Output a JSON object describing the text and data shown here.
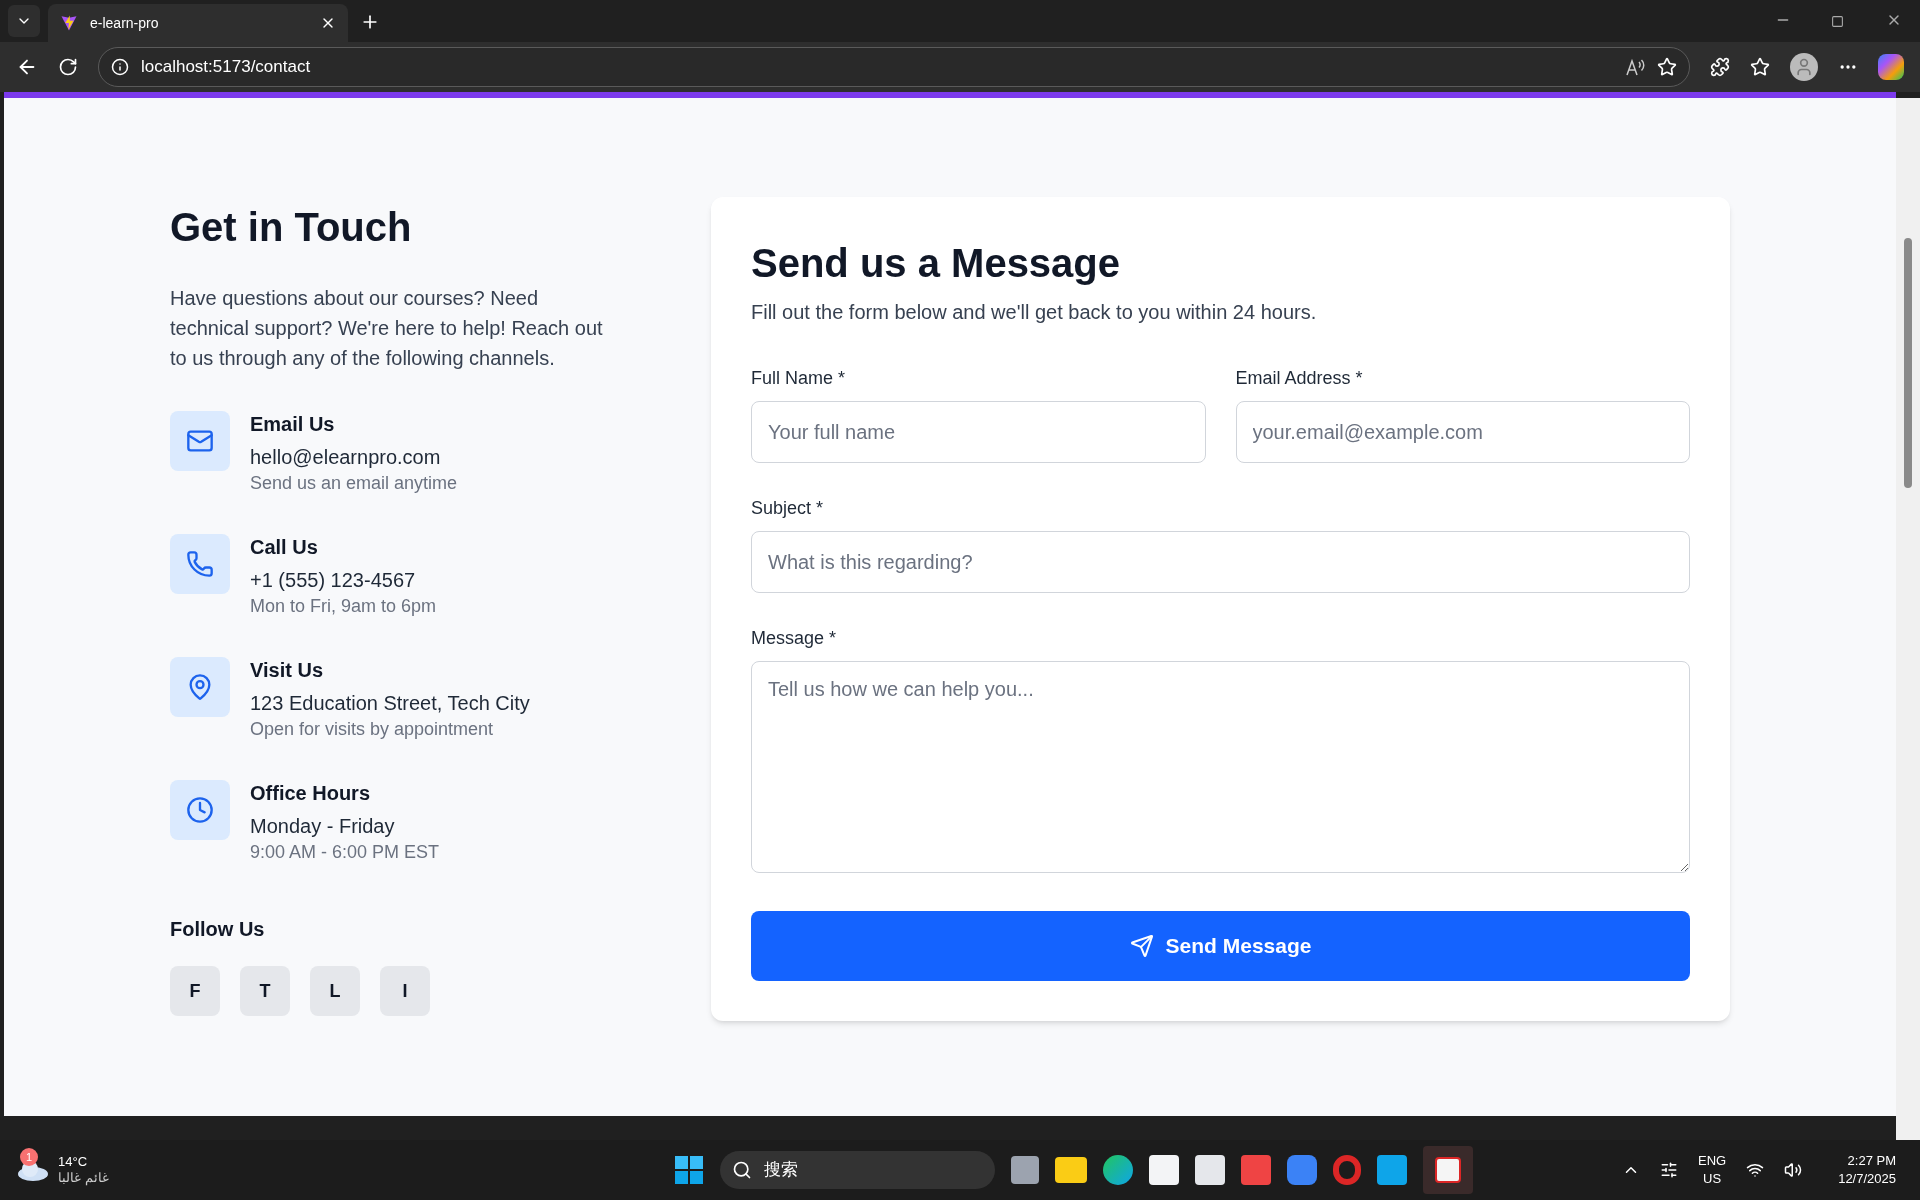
{
  "browser": {
    "tab_title": "e-learn-pro",
    "url": "localhost:5173/contact"
  },
  "contact_info": {
    "title": "Get in Touch",
    "intro": "Have questions about our courses? Need technical support? We're here to help! Reach out to us through any of the following channels.",
    "channels": [
      {
        "kind": "email",
        "title": "Email Us",
        "value": "hello@elearnpro.com",
        "note": "Send us an email anytime"
      },
      {
        "kind": "phone",
        "title": "Call Us",
        "value": "+1 (555) 123-4567",
        "note": "Mon to Fri, 9am to 6pm"
      },
      {
        "kind": "location",
        "title": "Visit Us",
        "value": "123 Education Street, Tech City",
        "note": "Open for visits by appointment"
      },
      {
        "kind": "hours",
        "title": "Office Hours",
        "value": "Monday - Friday",
        "note": "9:00 AM - 6:00 PM EST"
      }
    ],
    "follow_title": "Follow Us",
    "social": [
      "F",
      "T",
      "L",
      "I"
    ]
  },
  "form": {
    "title": "Send us a Message",
    "subtitle": "Fill out the form below and we'll get back to you within 24 hours.",
    "fields": [
      {
        "kind": "input",
        "label": "Full Name *",
        "placeholder": "Your full name"
      },
      {
        "kind": "input",
        "label": "Email Address *",
        "placeholder": "your.email@example.com"
      },
      {
        "kind": "input",
        "label": "Subject *",
        "placeholder": "What is this regarding?"
      },
      {
        "kind": "textarea",
        "label": "Message *",
        "placeholder": "Tell us how we can help you..."
      }
    ],
    "submit": "Send Message"
  },
  "taskbar": {
    "weather_temp": "14°C",
    "weather_text": "غائم غالبا",
    "weather_badge": "1",
    "search": "搜索",
    "lang": "ENG",
    "region": "US",
    "time": "2:27 PM",
    "date": "12/7/2025"
  }
}
